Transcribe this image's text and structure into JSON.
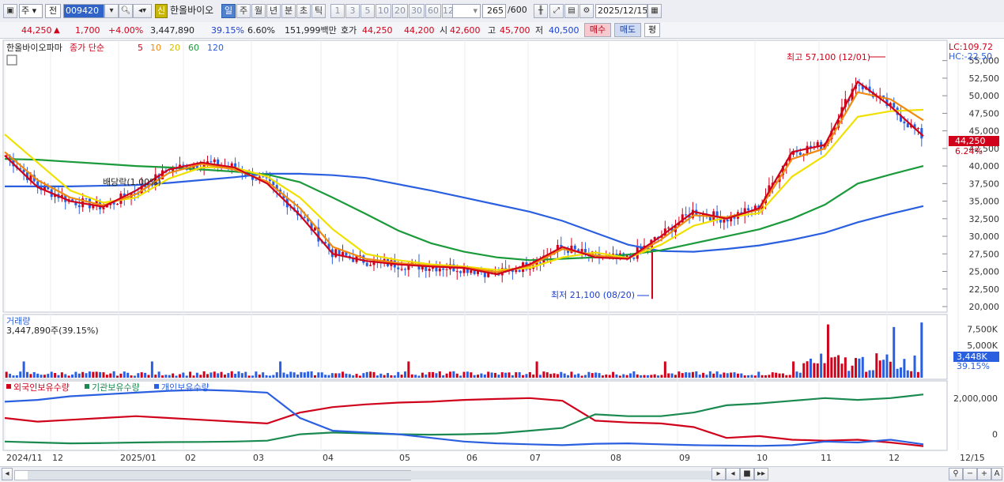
{
  "toolbar": {
    "market": "주",
    "period_sel": "전",
    "code": "009420",
    "sin_label": "신",
    "name": "한올바이오",
    "periods": [
      "일",
      "주",
      "월",
      "년",
      "분",
      "초",
      "틱"
    ],
    "active_period": "일",
    "intervals": [
      "1",
      "3",
      "5",
      "10",
      "20",
      "30",
      "60",
      "120"
    ],
    "count": "265",
    "count_max": "/600",
    "date": "2025/12/15"
  },
  "quote": {
    "price": "44,250",
    "change": "1,700",
    "up_icon": "up-triangle-icon",
    "change_pct": "+4.00%",
    "volume": "3,447,890",
    "vol_ratio": "39.15%",
    "turnover": "6.60%",
    "amount": "151,999백만",
    "hoga_label": "호가",
    "ask": "44,250",
    "bid": "44,200",
    "open_label": "시",
    "open": "42,600",
    "high_label": "고",
    "high": "45,700",
    "low_label": "저",
    "low": "40,500",
    "buy": "매수",
    "sell": "매도",
    "eval": "평"
  },
  "price_panel": {
    "title": "한올바이오파마",
    "ma_label": "종가 단순",
    "ma_periods": [
      "5",
      "10",
      "20",
      "60",
      "120"
    ],
    "ma_colors": [
      "#d0021b",
      "#f08a10",
      "#f0e000",
      "#1a9a3a",
      "#2a5fe0"
    ],
    "lc": "LC:109.72",
    "hc": "HC:-22.50",
    "yticks": [
      "55,000",
      "52,500",
      "50,000",
      "47,500",
      "45,000",
      "42,500",
      "40,000",
      "37,500",
      "35,000",
      "32,500",
      "30,000",
      "27,500",
      "25,000",
      "22,500",
      "20,000"
    ],
    "price_badge": "44,250",
    "pct_badge": "6.24%",
    "dividend_label": "배당락(1.00%)",
    "high_ann": "최고 57,100 (12/01)",
    "low_ann": "최저 21,100 (08/20)"
  },
  "volume_panel": {
    "title": "거래량",
    "sub": "3,447,890주(39.15%)",
    "yticks": [
      "7,500K",
      "5,000K"
    ],
    "badge": "3,448K",
    "badge_pct": "39.15%"
  },
  "holder_panel": {
    "legend": [
      "외국인보유수량",
      "기관보유수량",
      "개인보유수량"
    ],
    "legend_colors": [
      "#d0021b",
      "#1a8a50",
      "#2a5fe0"
    ],
    "yticks": [
      "2,000,000",
      "0"
    ]
  },
  "xaxis": {
    "labels": [
      "2024/11",
      "12",
      "2025/01",
      "02",
      "03",
      "04",
      "05",
      "06",
      "07",
      "08",
      "09",
      "10",
      "11",
      "12",
      "12/15"
    ]
  },
  "chart_data": {
    "type": "line",
    "title": "한올바이오파마",
    "xlabel": "",
    "ylabel": "",
    "ylim": [
      20000,
      57100
    ],
    "x": [
      "2024/11",
      "2024/11",
      "12",
      "12",
      "2025/01",
      "01",
      "02",
      "02",
      "03",
      "03",
      "04",
      "04",
      "05",
      "05",
      "06",
      "06",
      "07",
      "07",
      "08",
      "08",
      "09",
      "09",
      "10",
      "10",
      "11",
      "11",
      "12",
      "12",
      "12/15"
    ],
    "series": [
      {
        "name": "5",
        "values": [
          41500,
          37000,
          35000,
          34200,
          36500,
          39500,
          40500,
          39800,
          37500,
          33000,
          27500,
          26500,
          26000,
          25700,
          25500,
          24600,
          26000,
          28500,
          27000,
          26800,
          30000,
          33500,
          32500,
          34000,
          42000,
          43000,
          52000,
          48500,
          44250
        ]
      },
      {
        "name": "10",
        "values": [
          42000,
          38000,
          35500,
          34400,
          36000,
          39000,
          40300,
          39500,
          37800,
          34000,
          28500,
          26800,
          26200,
          25800,
          25600,
          24900,
          25800,
          28200,
          27300,
          26800,
          29500,
          33000,
          32700,
          33800,
          41000,
          42500,
          50500,
          49500,
          46500
        ]
      },
      {
        "name": "20",
        "values": [
          44500,
          40500,
          36500,
          34800,
          35500,
          38200,
          39800,
          39800,
          38500,
          35500,
          31000,
          27500,
          26600,
          26000,
          25700,
          25200,
          25500,
          27000,
          27700,
          26900,
          28800,
          31500,
          32700,
          33300,
          38500,
          41500,
          47000,
          47800,
          48000
        ]
      },
      {
        "name": "60",
        "values": [
          41000,
          40900,
          40600,
          40300,
          40000,
          39800,
          39500,
          39200,
          38800,
          37700,
          35500,
          33200,
          30800,
          29000,
          27800,
          27000,
          26600,
          26800,
          27000,
          27400,
          28000,
          29000,
          30000,
          31000,
          32500,
          34500,
          37500,
          38800,
          40000
        ]
      },
      {
        "name": "120",
        "values": [
          37100,
          37100,
          37100,
          37200,
          37300,
          37600,
          38000,
          38400,
          38900,
          38900,
          38700,
          38300,
          37400,
          36500,
          35500,
          34500,
          33500,
          32200,
          30500,
          28800,
          27900,
          27800,
          28200,
          28700,
          29500,
          30500,
          32000,
          33200,
          34300
        ]
      }
    ],
    "high": {
      "value": 57100,
      "date": "12/01"
    },
    "low": {
      "value": 21100,
      "date": "08/20"
    },
    "volume": {
      "unit": "주",
      "last": 3447890,
      "peaks": [
        {
          "x": "11",
          "value": 8200000
        },
        {
          "x": "12",
          "value": 7800000
        },
        {
          "x": "12/15",
          "value": 8500000
        }
      ],
      "ylim": [
        0,
        9000000
      ]
    },
    "holders": {
      "ylim": [
        -800000,
        2600000
      ],
      "series": [
        {
          "name": "외국인보유수량",
          "values": [
            900000,
            700000,
            800000,
            900000,
            1000000,
            900000,
            800000,
            700000,
            600000,
            1200000,
            1500000,
            1650000,
            1750000,
            1800000,
            1900000,
            1950000,
            2000000,
            1850000,
            750000,
            650000,
            600000,
            400000,
            -200000,
            -100000,
            -300000,
            -350000,
            -300000,
            -450000,
            -650000
          ]
        },
        {
          "name": "기관보유수량",
          "values": [
            -400000,
            -450000,
            -500000,
            -480000,
            -450000,
            -430000,
            -420000,
            -400000,
            -350000,
            0,
            100000,
            50000,
            0,
            -20000,
            0,
            50000,
            200000,
            350000,
            1100000,
            1000000,
            1000000,
            1200000,
            1600000,
            1700000,
            1850000,
            2000000,
            1900000,
            2000000,
            2200000
          ]
        },
        {
          "name": "개인보유수량",
          "values": [
            1800000,
            1900000,
            2100000,
            2200000,
            2300000,
            2400000,
            2450000,
            2400000,
            2300000,
            900000,
            200000,
            100000,
            0,
            -200000,
            -400000,
            -500000,
            -550000,
            -600000,
            -520000,
            -500000,
            -550000,
            -600000,
            -620000,
            -640000,
            -600000,
            -400000,
            -450000,
            -300000,
            -550000
          ]
        }
      ]
    }
  }
}
